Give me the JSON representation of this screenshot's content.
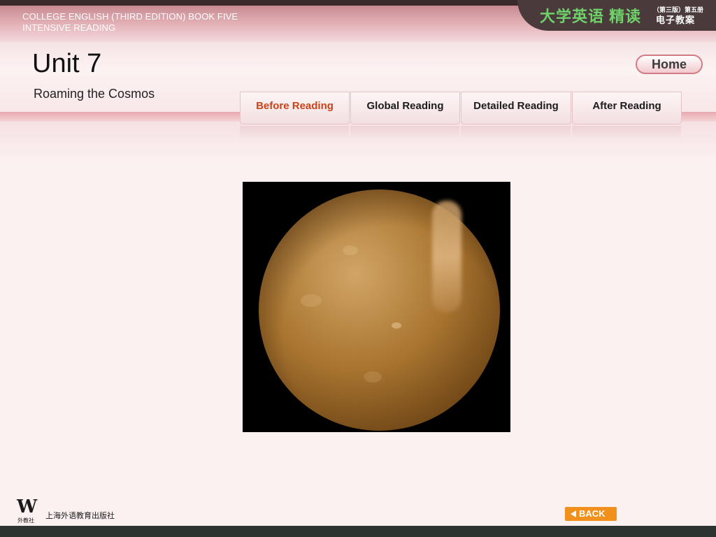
{
  "header": {
    "line1": "COLLEGE ENGLISH (THIRD EDITION) BOOK FIVE",
    "line2": "INTENSIVE READING",
    "brand_main": "大学英语 精读",
    "brand_edition": "（第三版）第五册",
    "brand_sub": "电子教案"
  },
  "unit": {
    "title": "Unit 7",
    "subtitle": "Roaming the Cosmos"
  },
  "home_label": "Home",
  "tabs": [
    {
      "label": "Before Reading",
      "active": true
    },
    {
      "label": "Global Reading",
      "active": false
    },
    {
      "label": "Detailed Reading",
      "active": false
    },
    {
      "label": "After Reading",
      "active": false
    }
  ],
  "content": {
    "image_icon": "planet-mercury-photo"
  },
  "footer": {
    "logo_mark": "W",
    "logo_sub": "外教社",
    "publisher": "上海外语教育出版社",
    "back_label": "BACK"
  },
  "colors": {
    "active_tab": "#c9431a",
    "back_button": "#f2901e",
    "brand_green": "#6fd16a"
  }
}
